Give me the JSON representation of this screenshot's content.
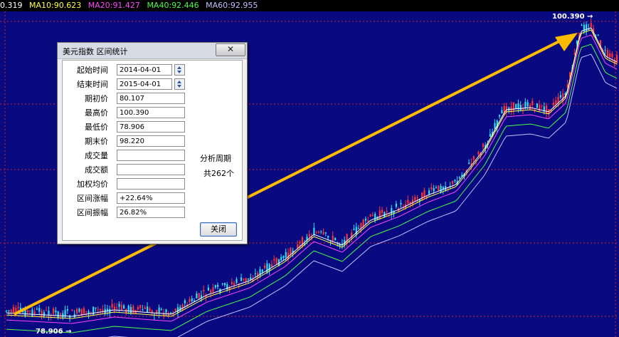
{
  "ma_bar": [
    {
      "text": "0.319",
      "color": "#ffffff"
    },
    {
      "text": "MA10:90.623",
      "color": "#ffff44"
    },
    {
      "text": "MA20:91.427",
      "color": "#ff44ff"
    },
    {
      "text": "MA40:92.446",
      "color": "#44ff44"
    },
    {
      "text": "MA60:92.955",
      "color": "#c0c0ff"
    }
  ],
  "chart": {
    "peak_label": "100.390",
    "low_label": "78.906",
    "colors": {
      "background": "#0a0a80",
      "grid": "#cc2222",
      "up_candle": "#ff3333",
      "down_candle": "#33ddee",
      "ma5": "#ffffff",
      "ma10": "#ffff44",
      "ma20": "#ff44ff",
      "ma40": "#44ff44",
      "ma60": "#c0c0ff",
      "arrow": "#ffbb00"
    },
    "trend_arrow": {
      "from": "78.906",
      "to": "100.390"
    }
  },
  "dialog": {
    "title": "美元指数 区间统计",
    "close_icon": "✕",
    "rows": [
      {
        "label": "起始时间",
        "value": "2014-04-01",
        "kind": "date"
      },
      {
        "label": "结束时间",
        "value": "2015-04-01",
        "kind": "date"
      },
      {
        "label": "期初价",
        "value": "80.107",
        "kind": "text"
      },
      {
        "label": "最高价",
        "value": "100.390",
        "kind": "text"
      },
      {
        "label": "最低价",
        "value": "78.906",
        "kind": "text"
      },
      {
        "label": "期末价",
        "value": "98.220",
        "kind": "text"
      },
      {
        "label": "成交量",
        "value": "",
        "kind": "text"
      },
      {
        "label": "成交额",
        "value": "",
        "kind": "text"
      },
      {
        "label": "加权均价",
        "value": "",
        "kind": "text"
      },
      {
        "label": "区间涨幅",
        "value": "+22.64%",
        "kind": "text"
      },
      {
        "label": "区间振幅",
        "value": "26.82%",
        "kind": "text"
      }
    ],
    "period_label": "分析周期",
    "period_count": "共262个",
    "close_button": "关闭"
  }
}
